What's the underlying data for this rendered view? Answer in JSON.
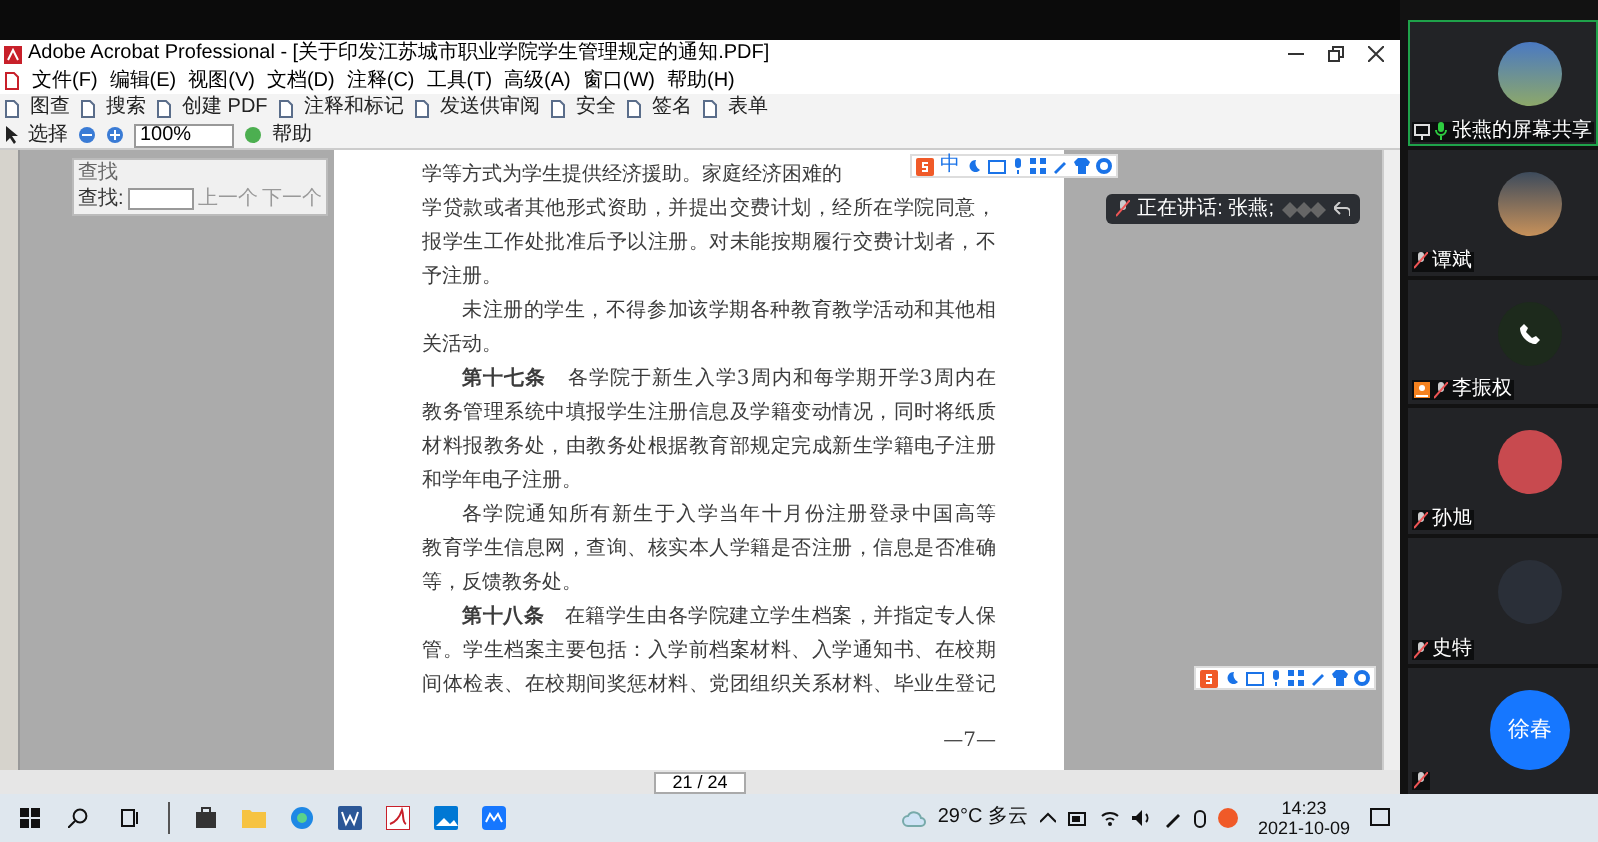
{
  "window": {
    "title": "Adobe Acrobat Professional - [关于印发江苏城市职业学院学生管理规定的通知.PDF]"
  },
  "menu": [
    "文件(F)",
    "编辑(E)",
    "视图(V)",
    "文档(D)",
    "注释(C)",
    "工具(T)",
    "高级(A)",
    "窗口(W)",
    "帮助(H)"
  ],
  "toolbar": [
    "图查",
    "搜索",
    "创建 PDF",
    "注释和标记",
    "发送供审阅",
    "安全",
    "签名",
    "表单"
  ],
  "toolbar_2": {
    "select": "选择",
    "zoom": "100%",
    "help": "帮助"
  },
  "find_panel": {
    "title": "查找",
    "label": "查找:",
    "previous": "上一个",
    "next": "下一个"
  },
  "document": {
    "lines": [
      {
        "kind": "last",
        "text": "学等方式为学生提供经济援助。家庭经济困难的"
      },
      {
        "kind": "cont",
        "text": "学贷款或者其他形式资助，并提出交费计划，经所在学院同意，"
      },
      {
        "kind": "cont",
        "text": "报学生工作处批准后予以注册。对未能按期履行交费计划者，不"
      },
      {
        "kind": "last",
        "text": "予注册。"
      },
      {
        "kind": "first",
        "text": "未注册的学生，不得参加该学期各种教育教学活动和其他相"
      },
      {
        "kind": "last",
        "text": "关活动。"
      },
      {
        "kind": "first",
        "text": "**第十七条**　各学院于新生入学3周内和每学期开学3周内在"
      },
      {
        "kind": "cont",
        "text": "教务管理系统中填报学生注册信息及学籍变动情况，同时将纸质"
      },
      {
        "kind": "cont",
        "text": "材料报教务处，由教务处根据教育部规定完成新生学籍电子注册"
      },
      {
        "kind": "last",
        "text": "和学年电子注册。"
      },
      {
        "kind": "first",
        "text": "各学院通知所有新生于入学当年十月份注册登录中国高等"
      },
      {
        "kind": "cont",
        "text": "教育学生信息网，查询、核实本人学籍是否注册，信息是否准确"
      },
      {
        "kind": "last",
        "text": "等，反馈教务处。"
      },
      {
        "kind": "first",
        "text": "**第十八条**　在籍学生由各学院建立学生档案，并指定专人保"
      },
      {
        "kind": "cont",
        "text": "管。学生档案主要包括：入学前档案材料、入学通知书、在校期"
      },
      {
        "kind": "cont",
        "text": "间体检表、在校期间奖惩材料、党团组织关系材料、毕业生登记"
      }
    ],
    "page_number": "—7—"
  },
  "ime_toolbar": {
    "mode": "中"
  },
  "speaking": {
    "label": "正在讲话: 张燕;"
  },
  "page_nav": "21 / 24",
  "participants": [
    {
      "name": "张燕的屏幕共享",
      "kind": "photo",
      "selected": true,
      "muted": false,
      "host": false,
      "sharing": true
    },
    {
      "name": "谭斌",
      "kind": "photo",
      "selected": false,
      "muted": true,
      "host": false,
      "sharing": false
    },
    {
      "name": "李振权",
      "kind": "phone",
      "selected": false,
      "muted": true,
      "host": true,
      "sharing": false
    },
    {
      "name": "孙旭",
      "kind": "photo",
      "selected": false,
      "muted": true,
      "host": false,
      "sharing": false
    },
    {
      "name": "史特",
      "kind": "photo",
      "selected": false,
      "muted": true,
      "host": false,
      "sharing": false
    },
    {
      "kind": "initials",
      "initials": "徐春",
      "selected": false,
      "muted": true,
      "host": false,
      "sharing": false
    }
  ],
  "taskbar": {
    "weather": "29°C 多云",
    "time": "14:23",
    "date": "2021-10-09"
  }
}
